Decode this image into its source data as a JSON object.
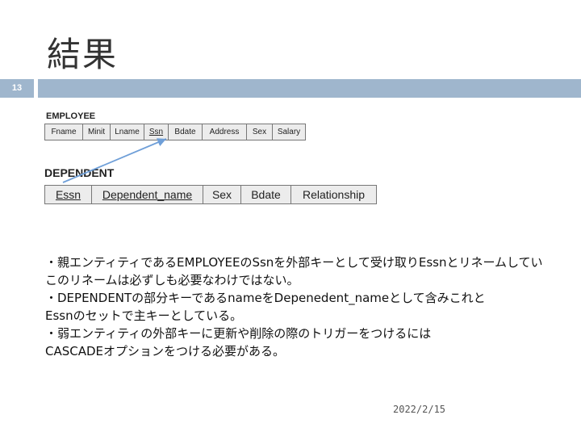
{
  "slide": {
    "title": "結果",
    "number": "13",
    "date": "2022/2/15"
  },
  "employee": {
    "name": "EMPLOYEE",
    "columns": [
      {
        "label": "Fname",
        "key": false
      },
      {
        "label": "Minit",
        "key": false
      },
      {
        "label": "Lname",
        "key": false
      },
      {
        "label": "Ssn",
        "key": true
      },
      {
        "label": "Bdate",
        "key": false
      },
      {
        "label": "Address",
        "key": false
      },
      {
        "label": "Sex",
        "key": false
      },
      {
        "label": "Salary",
        "key": false
      }
    ]
  },
  "dependent": {
    "name": "DEPENDENT",
    "columns": [
      {
        "label": "Essn",
        "key": true
      },
      {
        "label": "Dependent_name",
        "key": true
      },
      {
        "label": "Sex",
        "key": false
      },
      {
        "label": "Bdate",
        "key": false
      },
      {
        "label": "Relationship",
        "key": false
      }
    ]
  },
  "body_lines": [
    "・親エンティティであるEMPLOYEEのSsnを外部キーとして受け取りEssnとリネームしてい",
    "このリネームは必ずしも必要なわけではない。",
    "・DEPENDENTの部分キーであるnameをDepenedent_nameとして含みこれと",
    "Essnのセットで主キーとしている。",
    "・弱エンティティの外部キーに更新や削除の際のトリガーをつけるには",
    "CASCADEオプションをつける必要がある。"
  ],
  "colors": {
    "accent_bar": "#9fb6cd",
    "arrow": "#6f9fd8"
  }
}
